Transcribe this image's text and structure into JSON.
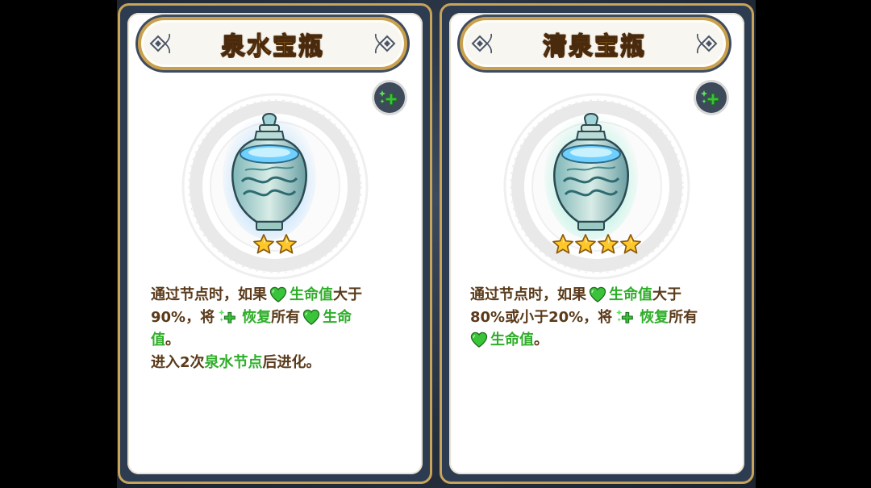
{
  "cards": [
    {
      "title": "泉水宝瓶",
      "stars": 2,
      "accent": "#3fa7ff",
      "desc": {
        "l1_a": "通过节点时，如果",
        "l1_b": "生命值",
        "l1_c": "大于",
        "l2_a": "90%，将",
        "l2_b": "恢复",
        "l2_c": "所有",
        "l2_d": "生命",
        "l3_a": "值",
        "l3_b": "。",
        "l4_a": "进入2次",
        "l4_b": "泉水节点",
        "l4_c": "后进化。"
      }
    },
    {
      "title": "清泉宝瓶",
      "stars": 4,
      "accent": "#37e0b0",
      "desc": {
        "l1_a": "通过节点时，如果",
        "l1_b": "生命值",
        "l1_c": "大于",
        "l2_a": "80%或小于20%，将",
        "l2_b": "恢复",
        "l2_c": "所有",
        "l3_b": "生命值",
        "l3_c": "。"
      }
    }
  ],
  "icons": {
    "badge": "green-sparkle-plus-icon",
    "heart": "green-heart-icon",
    "heal": "green-sparkle-plus-icon",
    "star": "gold-star-icon",
    "item": "water-vase-icon"
  },
  "colors": {
    "title_fill": "#f6b62e",
    "frame_gold": "#c7a45a",
    "desc_brown": "#5a3a1a",
    "keyword_green": "#2fae2a"
  }
}
